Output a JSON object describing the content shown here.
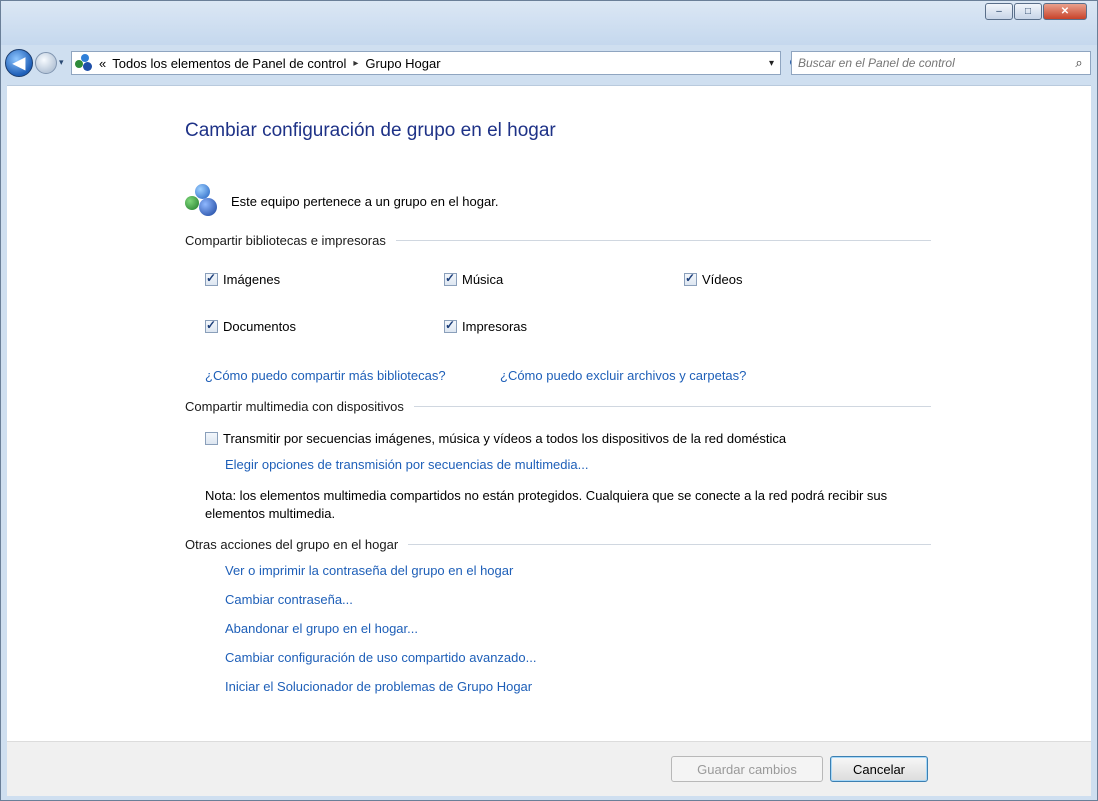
{
  "window": {
    "minimize_label": "–",
    "maximize_label": "□",
    "close_label": "✕"
  },
  "navbar": {
    "back_label": "◀",
    "history_dropdown": "▾",
    "address_prefix": "«",
    "breadcrumbs": [
      "Todos los elementos de Panel de control",
      "Grupo Hogar"
    ],
    "crumb_separator": "▸",
    "address_dropdown": "▾",
    "refresh_label": "⟳",
    "search_placeholder": "Buscar en el Panel de control",
    "search_icon": "⌕"
  },
  "main": {
    "title": "Cambiar configuración de grupo en el hogar",
    "status_text": "Este equipo pertenece a un grupo en el hogar.",
    "share_section": {
      "header": "Compartir bibliotecas e impresoras",
      "items": [
        {
          "label": "Imágenes",
          "checked": true
        },
        {
          "label": "Música",
          "checked": true
        },
        {
          "label": "Vídeos",
          "checked": true
        },
        {
          "label": "Documentos",
          "checked": true
        },
        {
          "label": "Impresoras",
          "checked": true
        }
      ],
      "links": [
        "¿Cómo puedo compartir más bibliotecas?",
        "¿Cómo puedo excluir archivos y carpetas?"
      ]
    },
    "media_section": {
      "header": "Compartir multimedia con dispositivos",
      "stream_checkbox": {
        "label": "Transmitir por secuencias imágenes, música y vídeos a todos los dispositivos de la red doméstica",
        "checked": false
      },
      "stream_options_link": "Elegir opciones de transmisión por secuencias de multimedia...",
      "note": "Nota: los elementos multimedia compartidos no están protegidos. Cualquiera que se conecte a la red podrá recibir sus elementos multimedia."
    },
    "other_section": {
      "header": "Otras acciones del grupo en el hogar",
      "links": [
        "Ver o imprimir la contraseña del grupo en el hogar",
        "Cambiar contraseña...",
        "Abandonar el grupo en el hogar...",
        "Cambiar configuración de uso compartido avanzado...",
        "Iniciar el Solucionador de problemas de Grupo Hogar"
      ]
    }
  },
  "footer": {
    "save_label": "Guardar cambios",
    "cancel_label": "Cancelar"
  },
  "colors": {
    "title_blue": "#1e3287",
    "link_blue": "#1e5fb8"
  }
}
